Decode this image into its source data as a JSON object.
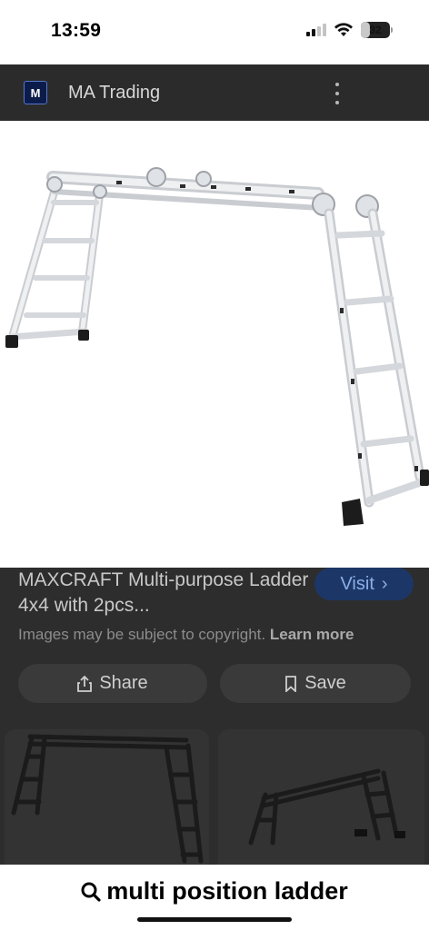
{
  "status_bar": {
    "time": "13:59",
    "battery": "32",
    "battery_level": 0.32
  },
  "source": {
    "logo_text": "M",
    "name": "MA Trading"
  },
  "result": {
    "title": "MAXCRAFT Multi-purpose Ladder 4x4 with 2pcs...",
    "visit_label": "Visit",
    "visit_chevron": "›",
    "copyright_text": "Images may be subject to copyright.",
    "learn_more": "Learn more"
  },
  "actions": {
    "share_label": "Share",
    "save_label": "Save"
  },
  "search": {
    "query": "multi position ladder"
  },
  "icons": {
    "more": "more-vert-icon",
    "share": "share-icon",
    "save": "bookmark-icon",
    "search": "search-icon"
  },
  "colors": {
    "dim_overlay": "#2d2d2d",
    "visit_button": "#1c3767",
    "visit_text": "#8caee8",
    "ladder_metal": "#e4e6e9"
  }
}
